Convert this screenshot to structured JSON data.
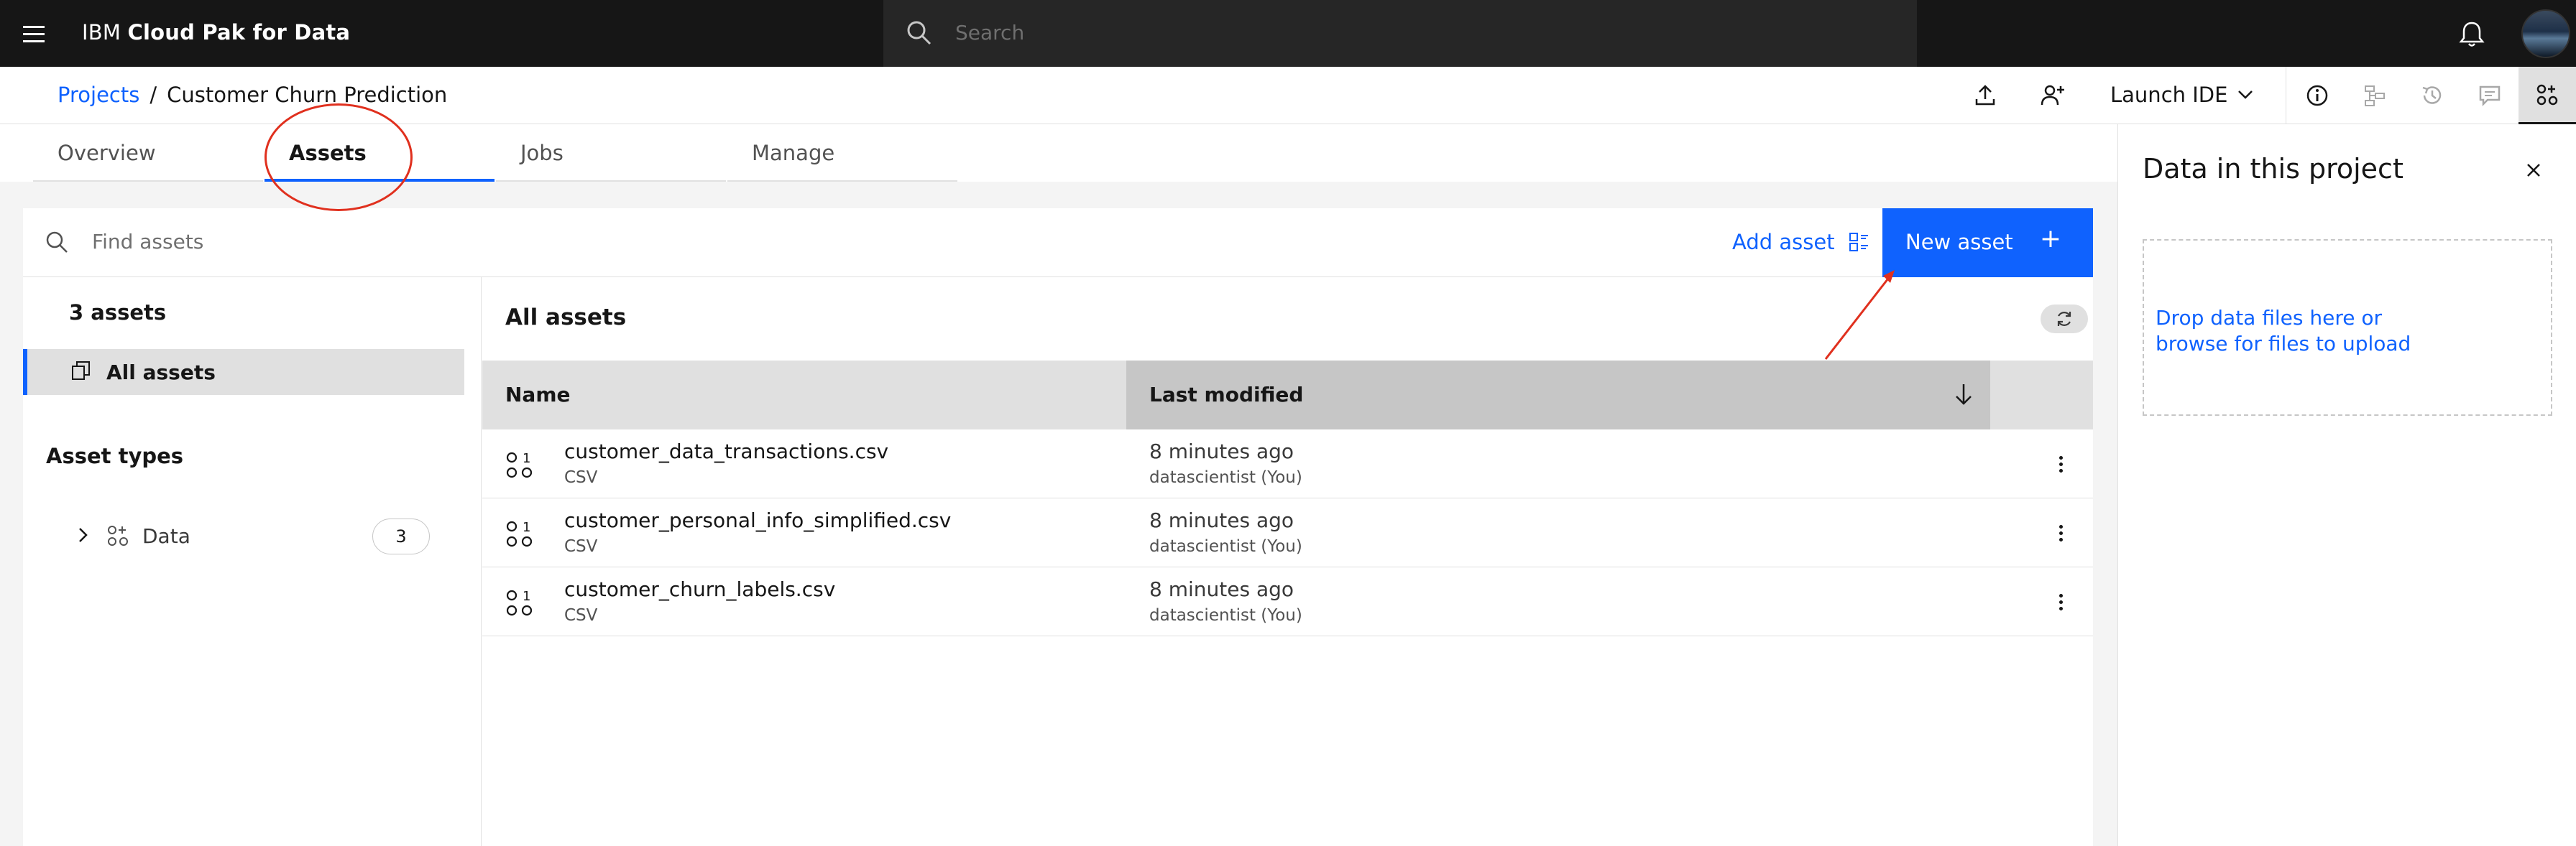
{
  "topbar": {
    "brand_prefix": "IBM",
    "brand_name": "Cloud Pak for Data",
    "search_placeholder": "Search"
  },
  "breadcrumb": {
    "projects": "Projects",
    "separator": "/",
    "current": "Customer Churn Prediction"
  },
  "toolbar": {
    "launch_ide": "Launch IDE"
  },
  "tabs": [
    {
      "label": "Overview"
    },
    {
      "label": "Assets",
      "active": true
    },
    {
      "label": "Jobs"
    },
    {
      "label": "Manage"
    }
  ],
  "assets": {
    "search_placeholder": "Find assets",
    "add_asset": "Add asset",
    "new_asset": "New asset",
    "new_asset_icon": "+",
    "count_label": "3 assets",
    "all_assets_nav": "All assets",
    "asset_types_heading": "Asset types",
    "data_type_label": "Data",
    "data_type_count": "3",
    "content_title": "All assets",
    "columns": {
      "name": "Name",
      "last_modified": "Last modified"
    },
    "rows": [
      {
        "name": "customer_data_transactions.csv",
        "type": "CSV",
        "modified": "8 minutes ago",
        "by": "datascientist (You)"
      },
      {
        "name": "customer_personal_info_simplified.csv",
        "type": "CSV",
        "modified": "8 minutes ago",
        "by": "datascientist (You)"
      },
      {
        "name": "customer_churn_labels.csv",
        "type": "CSV",
        "modified": "8 minutes ago",
        "by": "datascientist (You)"
      }
    ]
  },
  "side_panel": {
    "title": "Data in this project",
    "drop_line1": "Drop data files here or",
    "drop_line2": "browse for files to upload"
  },
  "colors": {
    "accent": "#0f62fe",
    "annotation": "#e0301e",
    "topbar": "#161616"
  }
}
